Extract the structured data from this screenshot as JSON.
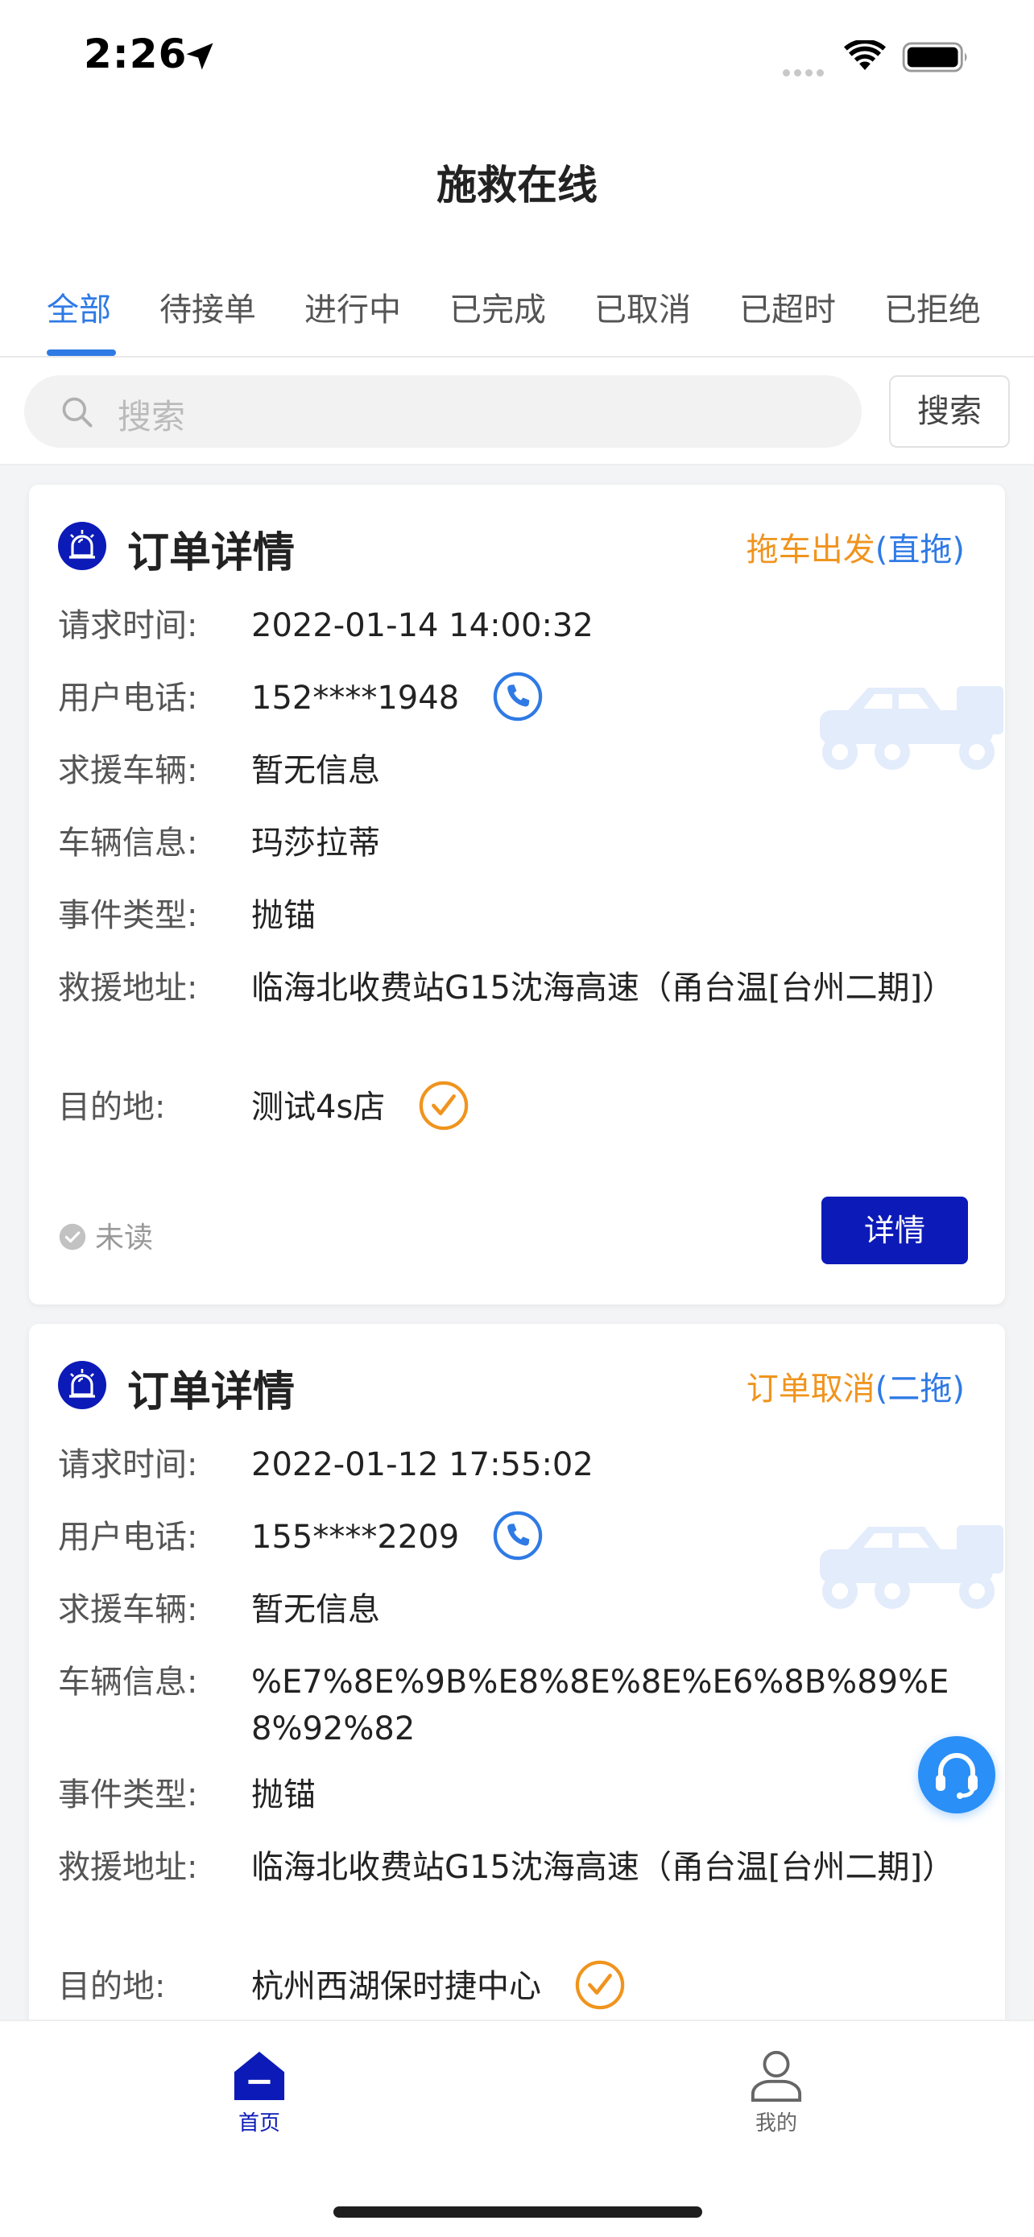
{
  "status_bar": {
    "time": "2:26"
  },
  "nav": {
    "title": "施救在线"
  },
  "tabs": [
    {
      "label": "全部",
      "active": true
    },
    {
      "label": "待接单",
      "active": false
    },
    {
      "label": "进行中",
      "active": false
    },
    {
      "label": "已完成",
      "active": false
    },
    {
      "label": "已取消",
      "active": false
    },
    {
      "label": "已超时",
      "active": false
    },
    {
      "label": "已拒绝",
      "active": false
    }
  ],
  "search": {
    "placeholder": "搜索",
    "button_label": "搜索"
  },
  "colors": {
    "primary_blue": "#2f7ae5",
    "navy": "#0c1ab8",
    "orange": "#f0941e",
    "support_blue": "#2a8ff7"
  },
  "orders": [
    {
      "title": "订单详情",
      "status": "拖车出发",
      "status_type": "(直拖)",
      "rows": [
        {
          "label": "请求时间:",
          "value": "2022-01-14 14:00:32"
        },
        {
          "label": "用户电话:",
          "value": "152****1948",
          "icon": "phone-icon"
        },
        {
          "label": "求援车辆:",
          "value": "暂无信息"
        },
        {
          "label": "车辆信息:",
          "value": "玛莎拉蒂"
        },
        {
          "label": "事件类型:",
          "value": "抛锚"
        },
        {
          "label": "救援地址:",
          "value": "临海北收费站G15沈海高速（甬台温[台州二期]）"
        },
        {
          "label": "目的地:",
          "value": "测试4s店",
          "icon": "check-circle-icon"
        }
      ],
      "read_state": "未读",
      "detail_label": "详情"
    },
    {
      "title": "订单详情",
      "status": "订单取消",
      "status_type": "(二拖)",
      "rows": [
        {
          "label": "请求时间:",
          "value": "2022-01-12 17:55:02"
        },
        {
          "label": "用户电话:",
          "value": "155****2209",
          "icon": "phone-icon"
        },
        {
          "label": "求援车辆:",
          "value": "暂无信息"
        },
        {
          "label": "车辆信息:",
          "value": "%E7%8E%9B%E8%8E%8E%E6%8B%89%E8%92%82"
        },
        {
          "label": "事件类型:",
          "value": "抛锚"
        },
        {
          "label": "救援地址:",
          "value": "临海北收费站G15沈海高速（甬台温[台州二期]）"
        },
        {
          "label": "目的地:",
          "value": "杭州西湖保时捷中心",
          "icon": "check-circle-icon"
        }
      ]
    }
  ],
  "tabbar": [
    {
      "label": "首页",
      "icon": "home-icon",
      "active": true
    },
    {
      "label": "我的",
      "icon": "user-icon",
      "active": false
    }
  ]
}
